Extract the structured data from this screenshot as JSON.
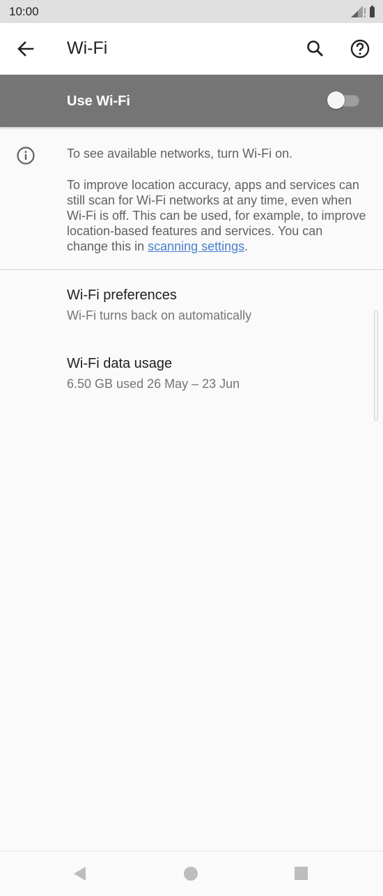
{
  "status_bar": {
    "time": "10:00",
    "icons": [
      "cell-signal-icon",
      "battery-icon"
    ]
  },
  "app_bar": {
    "title": "Wi-Fi",
    "icons": [
      "back-arrow-icon",
      "search-icon",
      "help-icon"
    ]
  },
  "master_switch": {
    "label": "Use Wi-Fi",
    "state": "off"
  },
  "info": {
    "icon": "info-icon",
    "line1": "To see available networks, turn Wi-Fi on.",
    "para_text": "To improve location accuracy, apps and services can still scan for Wi-Fi networks at any time, even when Wi-Fi is off. This can be used, for example, to improve location-based features and services. You can change this in ",
    "link": "scanning settings",
    "para_end": "."
  },
  "preferences": [
    {
      "title": "Wi-Fi preferences",
      "summary": "Wi-Fi turns back on automatically"
    },
    {
      "title": "Wi-Fi data usage",
      "summary": "6.50 GB used 26 May – 23 Jun"
    }
  ],
  "nav_bar": {
    "icons": [
      "nav-back-icon",
      "nav-home-icon",
      "nav-recents-icon"
    ]
  },
  "colors": {
    "status_bar": "#e0e0e0",
    "master_switch_bg": "#757575",
    "link": "#4a7ecf",
    "background": "#fafafa"
  }
}
